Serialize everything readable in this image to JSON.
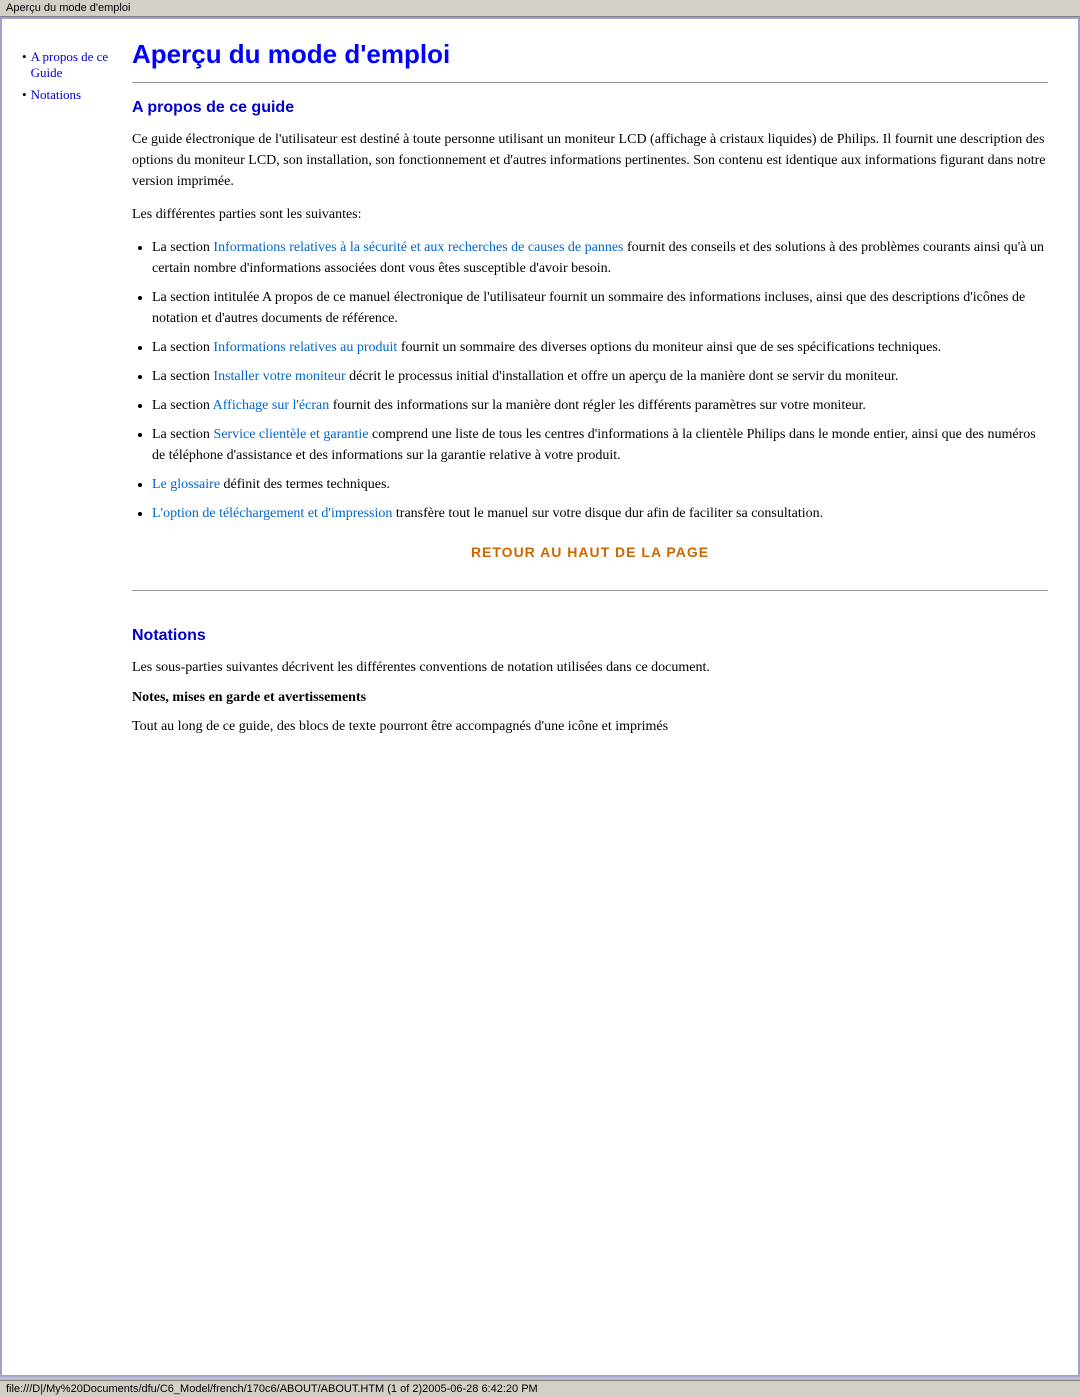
{
  "title_bar": {
    "text": "Aperçu du mode d'emploi"
  },
  "status_bar": {
    "text": "file:///D|/My%20Documents/dfu/C6_Model/french/170c6/ABOUT/ABOUT.HTM (1 of 2)2005-06-28 6:42:20 PM"
  },
  "sidebar": {
    "items": [
      {
        "label": "A propos de ce Guide",
        "href": "#apropos"
      },
      {
        "label": "Notations",
        "href": "#notations"
      }
    ]
  },
  "page": {
    "title": "Aperçu du mode d'emploi",
    "section1": {
      "title": "A propos de ce guide",
      "intro1": "Ce guide électronique de l'utilisateur est destiné à toute personne utilisant un moniteur LCD (affichage à cristaux liquides) de Philips. Il fournit une description des options du moniteur LCD, son installation, son fonctionnement et d'autres informations pertinentes. Son contenu est identique aux informations figurant dans notre version imprimée.",
      "intro2": "Les différentes parties sont les suivantes:",
      "list_items": [
        {
          "link_text": "Informations relatives à la sécurité et aux recherches de causes de pannes",
          "link_href": "#securite",
          "rest_text": " fournit des conseils et des solutions à des problèmes courants ainsi qu'à un certain nombre d'informations associées dont vous êtes susceptible d'avoir besoin."
        },
        {
          "link_text": "",
          "link_href": "",
          "rest_text": "La section intitulée A propos de ce manuel électronique de l'utilisateur fournit un sommaire des informations incluses, ainsi que des descriptions d'icônes de notation et d'autres documents de référence."
        },
        {
          "link_text": "Informations relatives au produit",
          "link_href": "#produit",
          "rest_text": " fournit un sommaire des diverses options du moniteur ainsi que de ses spécifications techniques."
        },
        {
          "link_text": "Installer votre moniteur",
          "link_href": "#installer",
          "rest_text": " décrit le processus initial d'installation et offre un aperçu de la manière dont se servir du moniteur."
        },
        {
          "link_text": "Affichage sur l'écran",
          "link_href": "#affichage",
          "rest_text": " fournit des informations sur la manière dont régler les différents paramètres sur votre moniteur."
        },
        {
          "link_text": "Service clientèle et garantie",
          "link_href": "#service",
          "rest_text": " comprend une liste de tous les centres d'informations à la clientèle Philips dans le monde entier, ainsi que des numéros de téléphone d'assistance et des informations sur la garantie relative à votre produit."
        },
        {
          "link_text": "Le glossaire",
          "link_href": "#glossaire",
          "rest_text": " définit des termes techniques."
        },
        {
          "link_text": "L'option de téléchargement et d'impression",
          "link_href": "#telechargement",
          "rest_text": " transfère tout le manuel sur votre disque dur afin de faciliter sa consultation."
        }
      ],
      "retour_label": "RETOUR AU HAUT DE LA PAGE",
      "retour_href": "#top"
    },
    "section2": {
      "title": "Notations",
      "intro": "Les sous-parties suivantes décrivent les différentes conventions de notation utilisées dans ce document.",
      "sub_title": "Notes, mises en garde et avertissements",
      "sub_text": "Tout au long de ce guide, des blocs de texte pourront être accompagnés d'une icône et imprimés"
    }
  }
}
